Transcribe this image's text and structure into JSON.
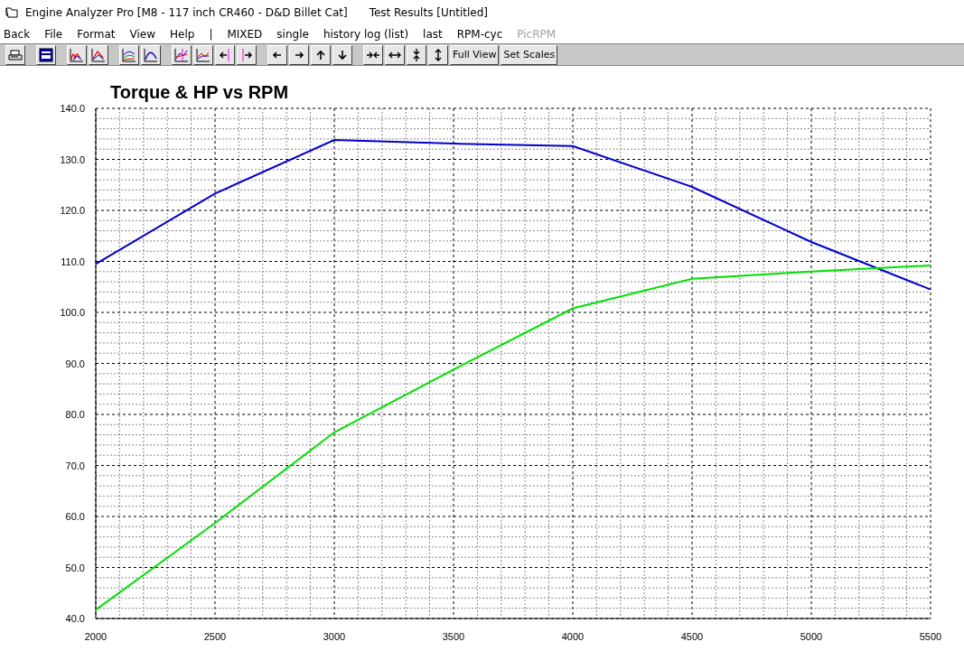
{
  "window": {
    "title": "Engine Analyzer Pro [M8 - 117 inch CR460 - D&D Billet Cat]",
    "subtitle": "Test Results [Untitled]"
  },
  "menu": [
    {
      "label": "Back",
      "disabled": false
    },
    {
      "label": "File",
      "disabled": false
    },
    {
      "label": "Format",
      "disabled": false
    },
    {
      "label": "View",
      "disabled": false
    },
    {
      "label": "Help",
      "disabled": false
    },
    {
      "label": "|",
      "disabled": false
    },
    {
      "label": "MIXED",
      "disabled": false
    },
    {
      "label": "single",
      "disabled": false
    },
    {
      "label": "history log (list)",
      "disabled": false
    },
    {
      "label": "last",
      "disabled": false
    },
    {
      "label": "RPM-cyc",
      "disabled": false
    },
    {
      "label": "PicRPM",
      "disabled": true
    }
  ],
  "toolbar": {
    "groups": [
      [
        {
          "kind": "icon"
        }
      ],
      [
        {
          "kind": "icon"
        }
      ],
      [
        {
          "kind": "icon"
        },
        {
          "kind": "icon"
        }
      ],
      [
        {
          "kind": "icon"
        },
        {
          "kind": "icon"
        }
      ],
      [
        {
          "kind": "icon"
        },
        {
          "kind": "icon"
        },
        {
          "kind": "icon"
        },
        {
          "kind": "icon"
        }
      ],
      [
        {
          "kind": "icon"
        },
        {
          "kind": "icon"
        },
        {
          "kind": "icon"
        },
        {
          "kind": "icon"
        }
      ],
      [
        {
          "kind": "icon"
        },
        {
          "kind": "icon"
        },
        {
          "kind": "icon"
        },
        {
          "kind": "icon"
        },
        {
          "kind": "text",
          "label": "Full View"
        },
        {
          "kind": "text",
          "label": "Set Scales"
        }
      ]
    ]
  },
  "chart": {
    "chart_data": {
      "type": "line",
      "title": "Torque & HP vs RPM",
      "x": [
        2000,
        2500,
        3000,
        3500,
        4000,
        4500,
        5000,
        5500
      ],
      "series": [
        {
          "color": "#0000cc",
          "values": [
            109.5,
            123.3,
            133.8,
            133.1,
            132.6,
            124.6,
            113.8,
            104.5
          ]
        },
        {
          "color": "#00e000",
          "values": [
            41.7,
            58.7,
            76.5,
            88.8,
            100.8,
            106.6,
            108.0,
            109.2
          ]
        }
      ],
      "grid": true,
      "xlim": [
        2000,
        5500
      ],
      "ylim": [
        40,
        140
      ],
      "xticks": [
        2000,
        2500,
        3000,
        3500,
        4000,
        4500,
        5000,
        5500
      ],
      "yticks": [
        {
          "value": 40,
          "label": "40.0"
        },
        {
          "value": 50,
          "label": "50.0"
        },
        {
          "value": 60,
          "label": "60.0"
        },
        {
          "value": 70,
          "label": "70.0"
        },
        {
          "value": 80,
          "label": "80.0"
        },
        {
          "value": 90,
          "label": "90.0"
        },
        {
          "value": 100,
          "label": "100.0"
        },
        {
          "value": 110,
          "label": "110.0"
        },
        {
          "value": 120,
          "label": "120.0"
        },
        {
          "value": 130,
          "label": "130.0"
        },
        {
          "value": 140,
          "label": "140.0"
        }
      ]
    }
  }
}
